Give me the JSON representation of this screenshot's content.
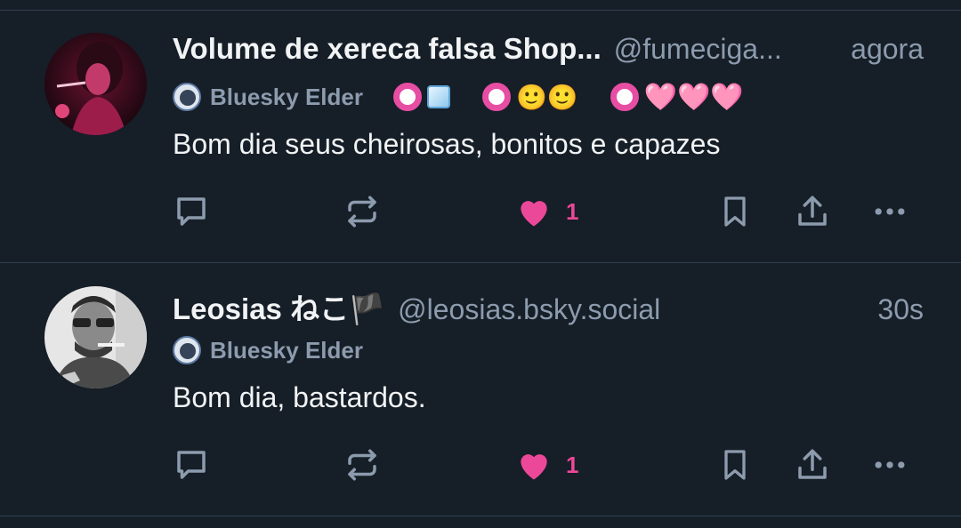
{
  "posts": [
    {
      "author_name": "Volume de xereca falsa Shop...",
      "handle": "@fumeciga...",
      "time": "agora",
      "badge_label": "Bluesky Elder",
      "emoji_groups": [
        "🧊",
        "🙂🙂",
        "🩷🩷🩷"
      ],
      "text": "Bom dia seus cheirosas, bonitos e capazes",
      "like_count": "1"
    },
    {
      "author_name": "Leosias ねこ🏴",
      "handle": "@leosias.bsky.social",
      "time": "30s",
      "badge_label": "Bluesky Elder",
      "text": "Bom dia, bastardos.",
      "like_count": "1"
    }
  ],
  "colors": {
    "background": "#161e27",
    "muted_text": "#8c9bad",
    "like_pink": "#ec4899",
    "divider": "#2e4052"
  },
  "icons": [
    "reply-icon",
    "repost-icon",
    "heart-icon",
    "bookmark-icon",
    "share-icon",
    "more-icon"
  ]
}
